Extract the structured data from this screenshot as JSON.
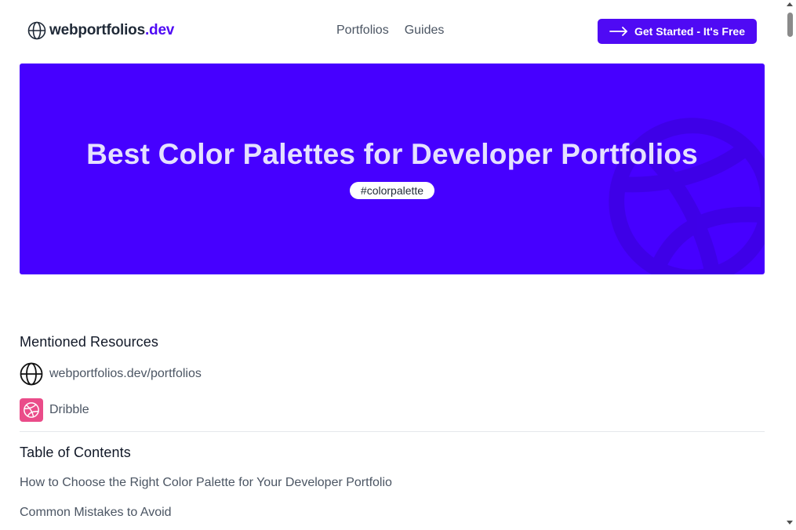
{
  "header": {
    "logo_main": "webportfolios",
    "logo_accent": ".dev",
    "nav": [
      {
        "label": "Portfolios"
      },
      {
        "label": "Guides"
      }
    ],
    "cta_label": "Get Started - It's Free"
  },
  "hero": {
    "title": "Best Color Palettes for Developer Portfolios",
    "tag": "#colorpalette",
    "background_color": "#4600ff"
  },
  "resources": {
    "title": "Mentioned Resources",
    "items": [
      {
        "label": "webportfolios.dev/portfolios",
        "icon": "globe-icon"
      },
      {
        "label": "Dribble",
        "icon": "dribbble-icon"
      }
    ]
  },
  "toc": {
    "title": "Table of Contents",
    "items": [
      {
        "label": "How to Choose the Right Color Palette for Your Developer Portfolio"
      },
      {
        "label": "Common Mistakes to Avoid"
      }
    ]
  },
  "colors": {
    "accent": "#4f0af4",
    "dribbble": "#ea4c89"
  }
}
